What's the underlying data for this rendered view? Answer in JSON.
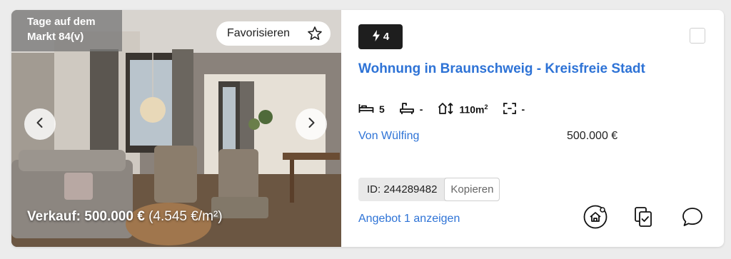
{
  "photo": {
    "days_on_market": "Tage auf dem Markt 84(v)",
    "favorite_label": "Favorisieren",
    "price_main": "Verkauf: 500.000 €",
    "price_sqm": "(4.545 €/m²)"
  },
  "listing": {
    "badge_count": "4",
    "title": "Wohnung in Braunschweig - Kreisfreie Stadt",
    "features": {
      "bedrooms": "5",
      "bathrooms": "-",
      "area": "110m",
      "area_sup": "2",
      "plot": "-"
    },
    "agent": "Von Wülfing",
    "price": "500.000 €",
    "id_label": "ID: 244289482",
    "copy_label": "Kopieren",
    "offer_link": "Angebot 1 anzeigen"
  },
  "icons": {
    "bolt": "bolt-icon",
    "star": "star-icon",
    "bed": "bed-icon",
    "bath": "bath-icon",
    "area": "area-icon",
    "plot": "plot-icon",
    "home_add": "home-search-icon",
    "copy": "copy-check-icon",
    "chat": "chat-icon"
  },
  "colors": {
    "link": "#2e73d6",
    "badge_bg": "#1e1e1e"
  }
}
